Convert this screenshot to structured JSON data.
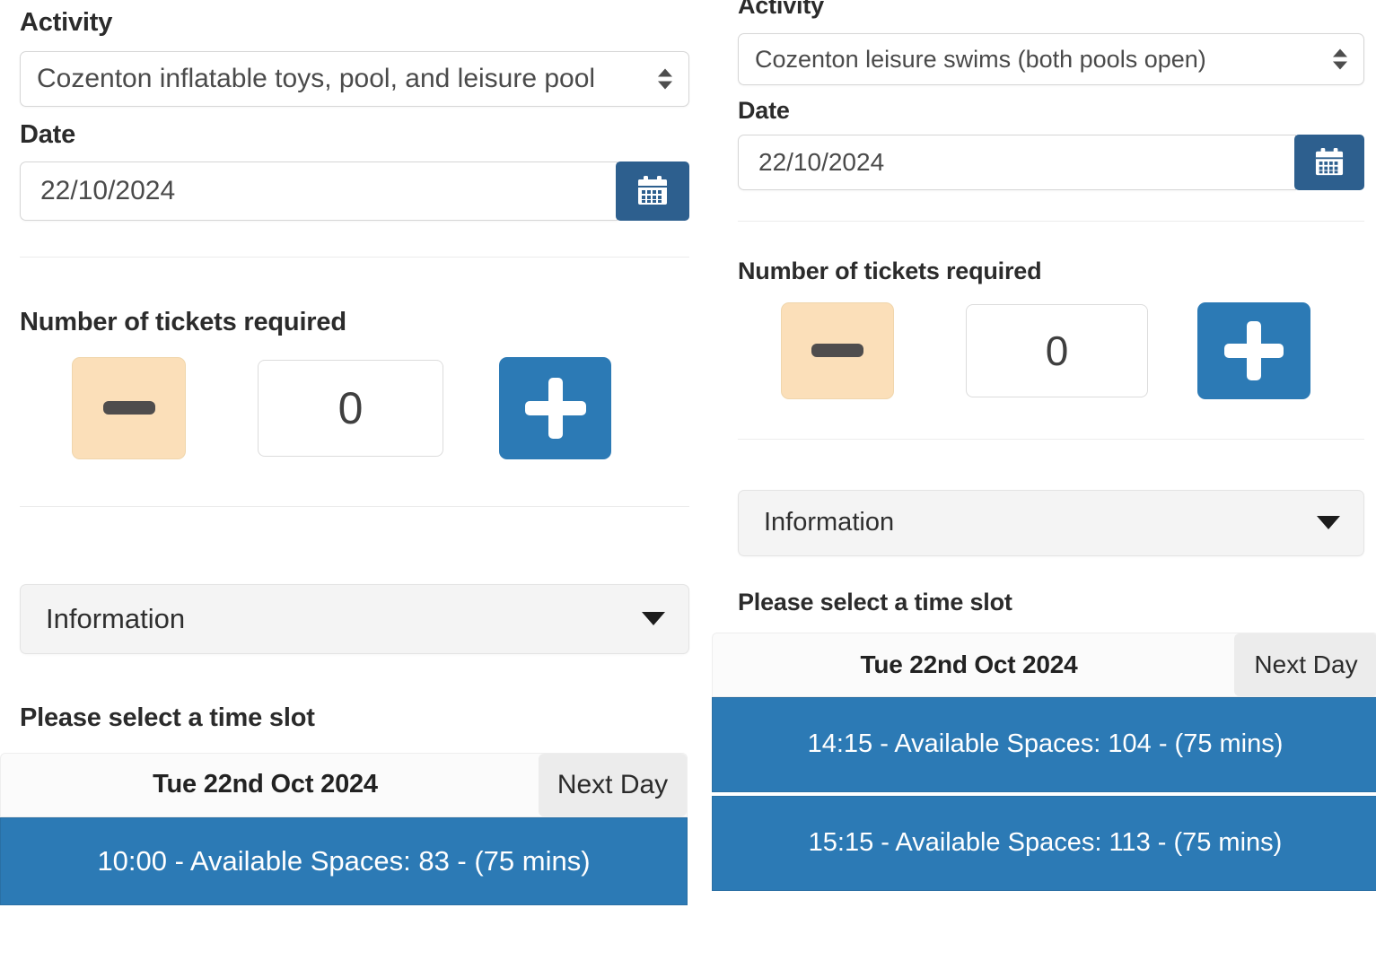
{
  "panels": [
    {
      "id": "left",
      "activity": {
        "label": "Activity",
        "selected": "Cozenton inflatable toys, pool, and leisure pool",
        "icon": "chevron-up-down-icon"
      },
      "date": {
        "label": "Date",
        "value": "22/10/2024",
        "calendar_icon": "calendar-icon"
      },
      "tickets": {
        "label": "Number of tickets required",
        "decrement_icon": "minus-icon",
        "increment_icon": "plus-icon",
        "quantity": "0"
      },
      "information": {
        "label": "Information",
        "icon": "chevron-down-icon"
      },
      "timeslot": {
        "heading": "Please select a time slot",
        "date_header": "Tue 22nd Oct 2024",
        "next_day_label": "Next Day",
        "slots": [
          "10:00 - Available Spaces: 83 - (75 mins)"
        ]
      }
    },
    {
      "id": "right",
      "activity": {
        "label": "Activity",
        "selected": "Cozenton leisure swims (both pools open)",
        "icon": "chevron-up-down-icon"
      },
      "date": {
        "label": "Date",
        "value": "22/10/2024",
        "calendar_icon": "calendar-icon"
      },
      "tickets": {
        "label": "Number of tickets required",
        "decrement_icon": "minus-icon",
        "increment_icon": "plus-icon",
        "quantity": "0"
      },
      "information": {
        "label": "Information",
        "icon": "chevron-down-icon"
      },
      "timeslot": {
        "heading": "Please select a time slot",
        "date_header": "Tue 22nd Oct 2024",
        "next_day_label": "Next Day",
        "slots": [
          "14:15 - Available Spaces: 104 - (75 mins)",
          "15:15 - Available Spaces: 113 - (75 mins)"
        ]
      }
    }
  ],
  "colors": {
    "primary_blue": "#2c7ab5",
    "calendar_blue": "#2d5f8e",
    "disabled_peach": "#fbdfb9",
    "accordion_grey": "#f4f4f4",
    "next_day_grey": "#ececec",
    "text_dark": "#2b2b2b"
  }
}
